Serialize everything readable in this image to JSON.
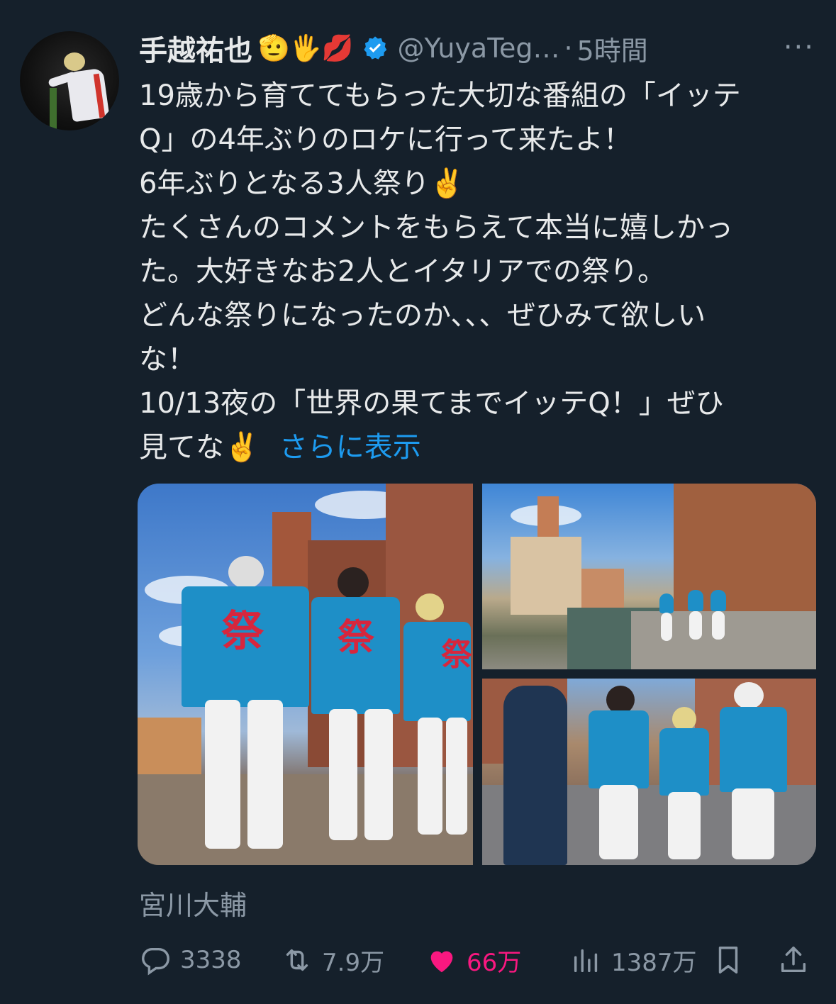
{
  "tweet": {
    "name": "手越祐也",
    "emojis": "🫡🖐💋",
    "handle": "@YuyaTeg…",
    "separator": "·",
    "time": "5時間",
    "more": "···",
    "text_lines": [
      "19歳から育ててもらった大切な番組の「イッテ",
      "Q」の4年ぶりのロケに行って来たよ！",
      "6年ぶりとなる3人祭り✌️",
      "たくさんのコメントをもらえて本当に嬉しかっ",
      "た。大好きなお2人とイタリアでの祭り。",
      "どんな祭りになったのか、、、ぜひみて欲しい",
      "な！",
      "10/13夜の「世界の果てまでイッテQ！」ぜひ",
      "見てな✌️"
    ],
    "show_more": "さらに表示",
    "location": "宮川大輔",
    "happi_kanji": "祭"
  },
  "actions": {
    "replies": "3338",
    "retweets": "7.9万",
    "likes": "66万",
    "views": "1387万"
  },
  "colors": {
    "background": "#15202b",
    "text": "#e7e9ea",
    "muted": "#8b98a5",
    "link": "#1d9bf0",
    "like": "#f91880",
    "verified": "#1d9bf0"
  }
}
